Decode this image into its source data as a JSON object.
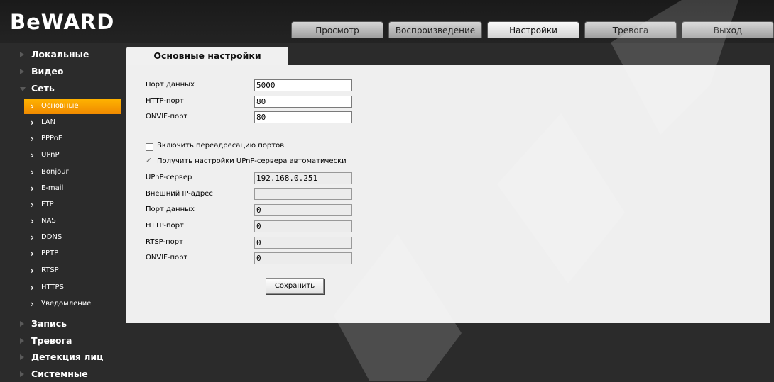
{
  "brand": "BeWARD",
  "tabs": [
    {
      "label": "Просмотр",
      "active": false
    },
    {
      "label": "Воспроизведение",
      "active": false
    },
    {
      "label": "Настройки",
      "active": true
    },
    {
      "label": "Тревога",
      "active": false
    },
    {
      "label": "Выход",
      "active": false
    }
  ],
  "sidebar": {
    "top": [
      {
        "label": "Локальные"
      },
      {
        "label": "Видео"
      },
      {
        "label": "Сеть",
        "expanded": true
      },
      {
        "label": "Запись"
      },
      {
        "label": "Тревога"
      },
      {
        "label": "Детекция лиц"
      },
      {
        "label": "Системные"
      }
    ],
    "sub": [
      {
        "label": "Основные",
        "active": true
      },
      {
        "label": "LAN"
      },
      {
        "label": "PPPoE"
      },
      {
        "label": "UPnP"
      },
      {
        "label": "Bonjour"
      },
      {
        "label": "E-mail"
      },
      {
        "label": "FTP"
      },
      {
        "label": "NAS"
      },
      {
        "label": "DDNS"
      },
      {
        "label": "PPTP"
      },
      {
        "label": "RTSP"
      },
      {
        "label": "HTTPS"
      },
      {
        "label": "Уведомление"
      }
    ]
  },
  "content": {
    "tab_title": "Основные настройки",
    "fields": [
      {
        "label": "Порт данных",
        "value": "5000"
      },
      {
        "label": "HTTP-порт",
        "value": "80"
      },
      {
        "label": "ONVIF-порт",
        "value": "80"
      }
    ],
    "port_forwarding": {
      "label": "Включить переадресацию портов",
      "checked": false
    },
    "upnp_auto": {
      "label": "Получить настройки UPnP-сервера автоматически",
      "checked": true
    },
    "upnp_fields": [
      {
        "label": "UPnP-сервер",
        "value": "192.168.0.251"
      },
      {
        "label": "Внешний IP-адрес",
        "value": ""
      },
      {
        "label": "Порт данных",
        "value": "0"
      },
      {
        "label": "HTTP-порт",
        "value": "0"
      },
      {
        "label": "RTSP-порт",
        "value": "0"
      },
      {
        "label": "ONVIF-порт",
        "value": "0"
      }
    ],
    "save_label": "Сохранить"
  },
  "watermark": "BEWARD",
  "colors": {
    "accent": "#f5a000",
    "panel": "#efefef",
    "background": "#2b2b2b"
  }
}
